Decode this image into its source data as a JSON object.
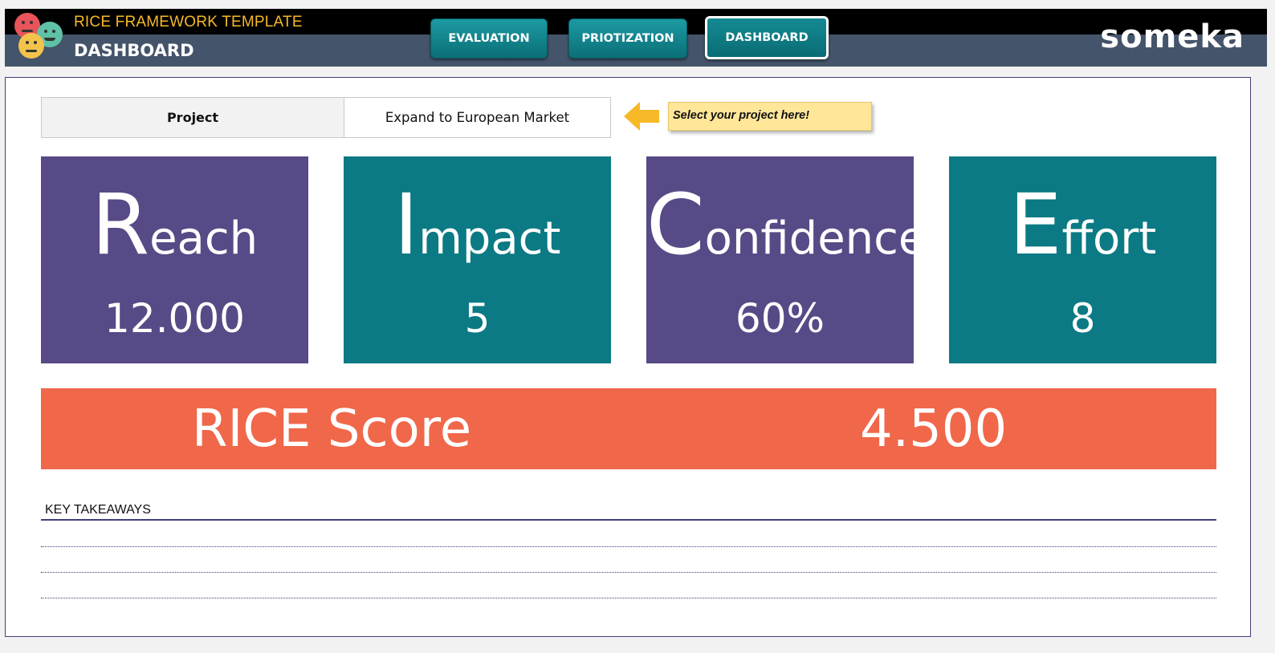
{
  "header": {
    "title_small": "RICE FRAMEWORK TEMPLATE",
    "title_big": "DASHBOARD",
    "brand": "someka",
    "nav": [
      {
        "label": "EVALUATION"
      },
      {
        "label": "PRIOTIZATION"
      },
      {
        "label": "DASHBOARD"
      }
    ]
  },
  "project": {
    "label": "Project",
    "value": "Expand to European Market",
    "hint": "Select your project here!"
  },
  "cards": [
    {
      "initial": "R",
      "rest": "each",
      "value": "12.000",
      "color": "#574a86"
    },
    {
      "initial": "I",
      "rest": "mpact",
      "value": "5",
      "color": "#0b7a84"
    },
    {
      "initial": "C",
      "rest": "onfidence",
      "value": "60%",
      "color": "#574a86"
    },
    {
      "initial": "E",
      "rest": "ffort",
      "value": "8",
      "color": "#0b7a84"
    }
  ],
  "rice": {
    "label": "RICE Score",
    "value": "4.500",
    "color": "#f0674a"
  },
  "takeaways": {
    "label": "KEY TAKEAWAYS"
  }
}
